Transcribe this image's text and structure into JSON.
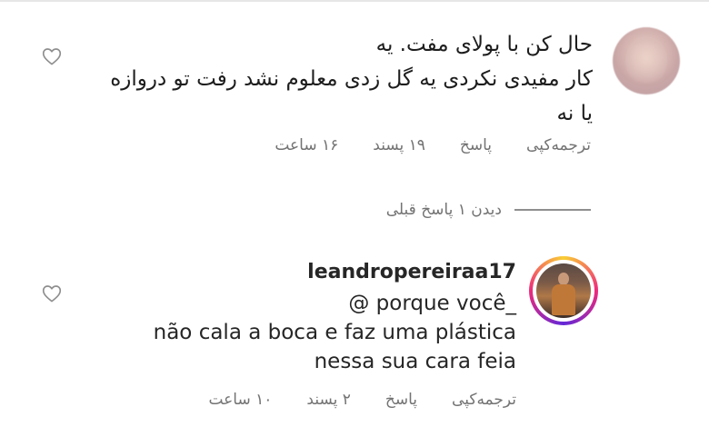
{
  "comments": [
    {
      "lines": [
        "حال کن با پولای مفت. یه",
        "کار مفیدی نکردی یه گل زدی معلوم نشد رفت تو دروازه",
        "یا نه"
      ],
      "time": "۱۶ ساعت",
      "likes": "۱۹ پسند",
      "reply": "پاسخ",
      "copy": "کپی",
      "translate": "ترجمه"
    },
    {
      "username": "leandropereiraa17",
      "lines": [
        "@ porque você_",
        "não cala a boca e faz uma plástica",
        "nessa sua cara feia"
      ],
      "time": "۱۰ ساعت",
      "likes": "۲ پسند",
      "reply": "پاسخ",
      "copy": "کپی",
      "translate": "ترجمه"
    }
  ],
  "view_replies": "دیدن ۱ پاسخ قبلی",
  "icons": {
    "like": "heart-outline-icon"
  },
  "colors": {
    "text": "#262626",
    "secondary": "#737373",
    "story_ring": "#ee2a7b"
  }
}
